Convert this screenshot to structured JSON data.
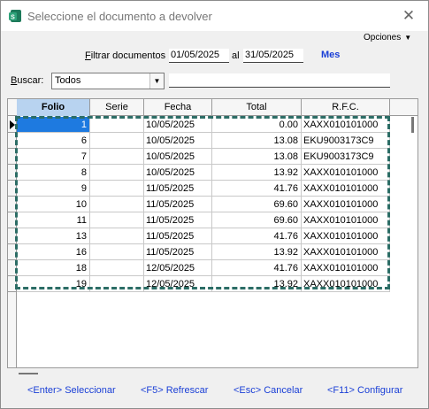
{
  "window": {
    "title": "Seleccione el documento a devolver",
    "close_glyph": "✕"
  },
  "options_menu": {
    "label": "Opciones",
    "arrow": "▼"
  },
  "filter": {
    "label_first": "F",
    "label_rest": "iltrar documentos",
    "date_from": "01/05/2025",
    "connector": "al",
    "date_to": "31/05/2025",
    "month_button": "Mes"
  },
  "search": {
    "label_first": "B",
    "label_rest": "uscar:",
    "combo_value": "Todos",
    "combo_arrow": "▼",
    "text_value": ""
  },
  "table": {
    "columns": [
      "Folio",
      "Serie",
      "Fecha",
      "Total",
      "R.F.C."
    ],
    "rows": [
      {
        "folio": "1",
        "serie": "",
        "fecha": "10/05/2025",
        "total": "0.00",
        "rfc": "XAXX010101000"
      },
      {
        "folio": "6",
        "serie": "",
        "fecha": "10/05/2025",
        "total": "13.08",
        "rfc": "EKU9003173C9"
      },
      {
        "folio": "7",
        "serie": "",
        "fecha": "10/05/2025",
        "total": "13.08",
        "rfc": "EKU9003173C9"
      },
      {
        "folio": "8",
        "serie": "",
        "fecha": "10/05/2025",
        "total": "13.92",
        "rfc": "XAXX010101000"
      },
      {
        "folio": "9",
        "serie": "",
        "fecha": "11/05/2025",
        "total": "41.76",
        "rfc": "XAXX010101000"
      },
      {
        "folio": "10",
        "serie": "",
        "fecha": "11/05/2025",
        "total": "69.60",
        "rfc": "XAXX010101000"
      },
      {
        "folio": "11",
        "serie": "",
        "fecha": "11/05/2025",
        "total": "69.60",
        "rfc": "XAXX010101000"
      },
      {
        "folio": "13",
        "serie": "",
        "fecha": "11/05/2025",
        "total": "41.76",
        "rfc": "XAXX010101000"
      },
      {
        "folio": "16",
        "serie": "",
        "fecha": "11/05/2025",
        "total": "13.92",
        "rfc": "XAXX010101000"
      },
      {
        "folio": "18",
        "serie": "",
        "fecha": "12/05/2025",
        "total": "41.76",
        "rfc": "XAXX010101000"
      },
      {
        "folio": "19",
        "serie": "",
        "fecha": "12/05/2025",
        "total": "13.92",
        "rfc": "XAXX010101000"
      }
    ]
  },
  "footer": {
    "select": "<Enter> Seleccionar",
    "refresh": "<F5> Refrescar",
    "cancel": "<Esc> Cancelar",
    "configure": "<F11> Configurar"
  },
  "colors": {
    "selection": "#1e7ae0",
    "header_active": "#b8d3f0",
    "link": "#1a3fd6",
    "focus_border": "#2c6d66"
  }
}
